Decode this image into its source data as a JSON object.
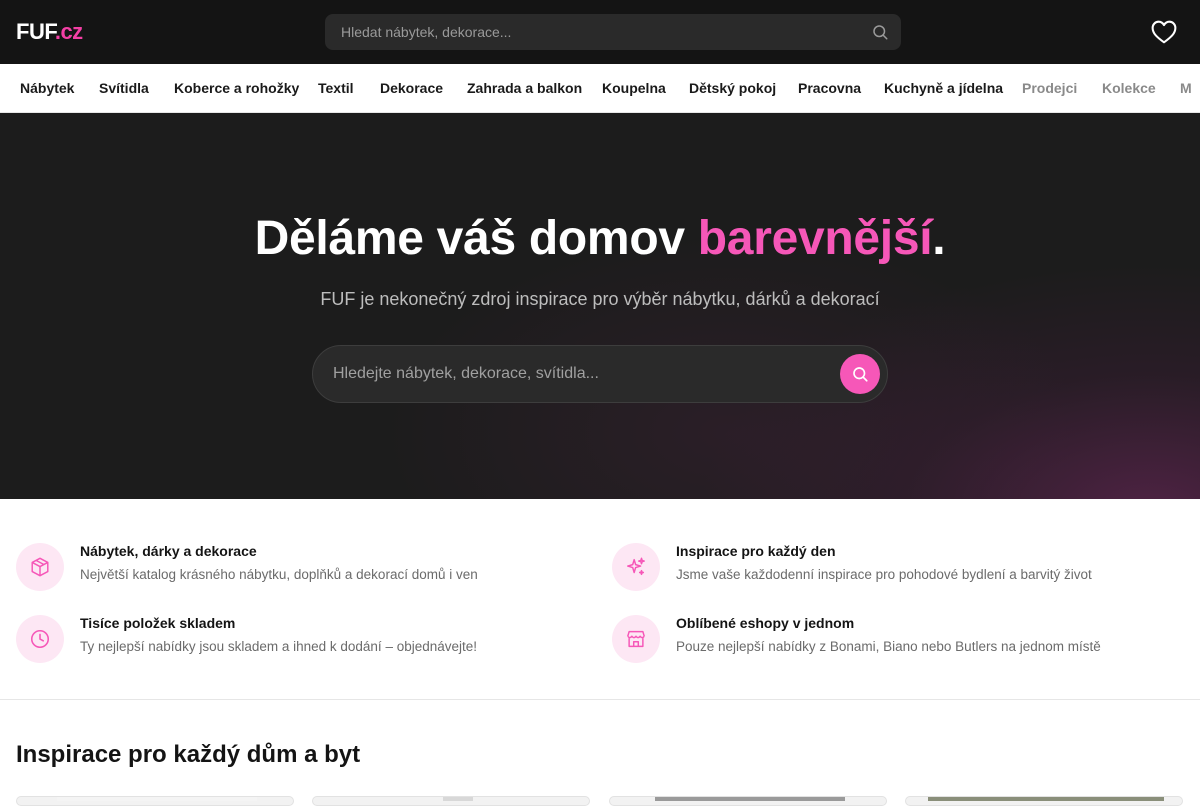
{
  "header": {
    "logo_main": "FUF",
    "logo_suffix": ".cz",
    "search_placeholder": "Hledat nábytek, dekorace...",
    "search_icon": "search-icon",
    "favorites_icon": "heart-icon"
  },
  "nav": {
    "items": [
      {
        "label": "Nábytek"
      },
      {
        "label": "Svítidla"
      },
      {
        "label": "Koberce a rohožky"
      },
      {
        "label": "Textil"
      },
      {
        "label": "Dekorace"
      },
      {
        "label": "Zahrada a balkon"
      },
      {
        "label": "Koupelna"
      },
      {
        "label": "Dětský pokoj"
      },
      {
        "label": "Pracovna"
      },
      {
        "label": "Kuchyně a jídelna"
      },
      {
        "label": "Prodejci"
      },
      {
        "label": "Kolekce"
      },
      {
        "label": "M"
      }
    ]
  },
  "hero": {
    "title_main": "Děláme váš domov ",
    "title_accent": "barevnější",
    "title_end": ".",
    "subtitle": "FUF je nekonečný zdroj inspirace pro výběr nábytku, dárků a dekorací",
    "search_placeholder": "Hledejte nábytek, dekorace, svítidla...",
    "accent_color": "#f657b8"
  },
  "features": [
    {
      "icon": "box-icon",
      "title": "Nábytek, dárky a dekorace",
      "desc": "Největší katalog krásného nábytku, doplňků a dekorací domů i ven"
    },
    {
      "icon": "sparkles-icon",
      "title": "Inspirace pro každý den",
      "desc": "Jsme vaše každodenní inspirace pro pohodové bydlení a barvitý život"
    },
    {
      "icon": "clock-icon",
      "title": "Tisíce položek skladem",
      "desc": "Ty nejlepší nabídky jsou skladem a ihned k dodání – objednávejte!"
    },
    {
      "icon": "store-icon",
      "title": "Oblíbené eshopy v jednom",
      "desc": "Pouze nejlepší nabídky z Bonami, Biano nebo Butlers na jednom místě"
    }
  ],
  "inspiration": {
    "title": "Inspirace pro každý dům a byt"
  }
}
